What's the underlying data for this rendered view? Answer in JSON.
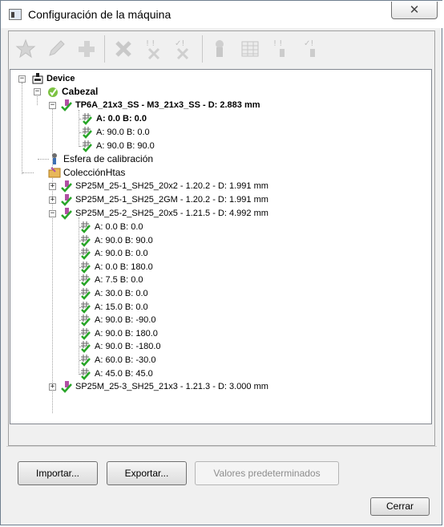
{
  "window": {
    "title": "Configuración de la máquina",
    "close_glyph": "✕"
  },
  "toolbar": {
    "icons": [
      "star-icon",
      "pencil-icon",
      "plus-icon",
      "delete-icon",
      "clear-unknown-icon",
      "clear-checked-icon",
      "probe-icon",
      "table-icon",
      "probe-unknown-icon",
      "probe-checked-icon"
    ]
  },
  "tree": {
    "device": "Device",
    "cabezal": "Cabezal",
    "tp6a": "TP6A_21x3_SS - M3_21x3_SS - D:  2.883 mm",
    "tp6a_orient": [
      "A:  0.0 B:  0.0",
      "A: 90.0 B:  0.0",
      "A: 90.0 B: 90.0"
    ],
    "esfera": "Esfera de calibración",
    "coleccion": "ColecciónHtas",
    "tools": [
      "SP25M_25-1_SH25_20x2 - 1.20.2 - D:  1.991 mm",
      "SP25M_25-1_SH25_2GM - 1.20.2 - D:  1.991 mm",
      "SP25M_25-2_SH25_20x5 - 1.21.5 - D:  4.992 mm"
    ],
    "tool2_orient": [
      "A:  0.0 B:  0.0",
      "A: 90.0 B: 90.0",
      "A: 90.0 B:  0.0",
      "A:  0.0 B: 180.0",
      "A:  7.5 B:  0.0",
      "A: 30.0 B:  0.0",
      "A: 15.0 B:  0.0",
      "A: 90.0 B: -90.0",
      "A: 90.0 B: 180.0",
      "A: 90.0 B: -180.0",
      "A: 60.0 B: -30.0",
      "A: 45.0 B: 45.0"
    ],
    "tool_last": "SP25M_25-3_SH25_21x3 - 1.21.3 - D:  3.000 mm"
  },
  "buttons": {
    "importar": "Importar...",
    "exportar": "Exportar...",
    "valores": "Valores predeterminados",
    "cerrar": "Cerrar"
  }
}
